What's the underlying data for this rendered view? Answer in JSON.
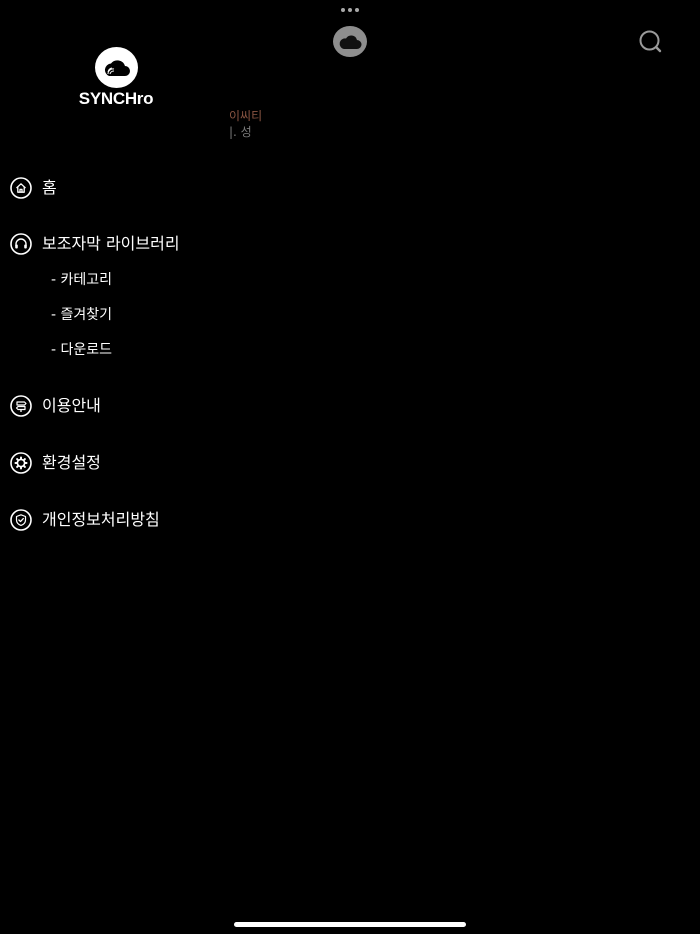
{
  "app": {
    "logo_text": "SYNCHro"
  },
  "background_preview": {
    "line1": "이씨티",
    "line2": "|. 성"
  },
  "menu": {
    "home": "홈",
    "library": "보조자막 라이브러리",
    "library_sub": [
      "- 카테고리",
      "- 즐겨찾기",
      "- 다운로드"
    ],
    "guide": "이용안내",
    "settings": "환경설정",
    "privacy": "개인정보처리방침"
  },
  "icons": {
    "top_center": "cloud-icon",
    "top_right": "search-icon",
    "home": "home-icon",
    "library": "headphones-icon",
    "guide": "signpost-icon",
    "settings": "gear-icon",
    "privacy": "shield-check-icon"
  },
  "colors": {
    "background": "#000000",
    "text": "#ffffff",
    "cloud_button": "#8e8e8e"
  }
}
